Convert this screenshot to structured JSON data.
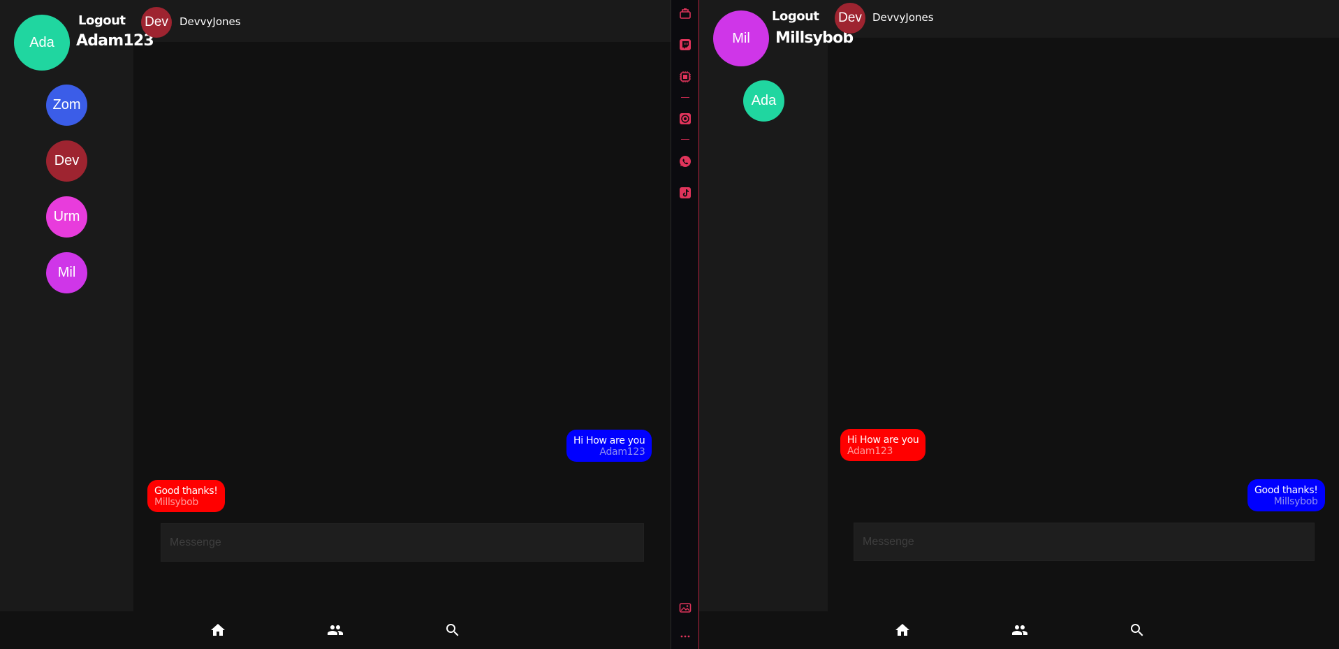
{
  "colors": {
    "background": "#111111",
    "panel": "#1a1a1a",
    "sent_bubble": "#0000ff",
    "received_bubble": "#ff0000",
    "accent_pink": "#e0345b"
  },
  "left": {
    "profile": {
      "initials": "Ada",
      "username": "Adam123",
      "color": "#20d6a0"
    },
    "logout_label": "Logout",
    "chat_header": {
      "initials": "Dev",
      "name": "DevvyJones",
      "color": "#9e2430"
    },
    "contacts": [
      {
        "initials": "Zom",
        "color": "#3b5de8"
      },
      {
        "initials": "Dev",
        "color": "#9e2430"
      },
      {
        "initials": "Urm",
        "color": "#e83cdc"
      },
      {
        "initials": "Mil",
        "color": "#cf36e8"
      }
    ],
    "messages": [
      {
        "text": "Hi How are you",
        "author": "Adam123",
        "side": "sent"
      },
      {
        "text": "Good thanks!",
        "author": "Millsybob",
        "side": "received"
      }
    ],
    "input_placeholder": "Messenge",
    "nav": [
      "home-icon",
      "people-icon",
      "search-icon"
    ]
  },
  "right": {
    "profile": {
      "initials": "Mil",
      "username": "Millsybob",
      "color": "#cf36e8"
    },
    "logout_label": "Logout",
    "chat_header": {
      "initials": "Dev",
      "name": "DevvyJones",
      "color": "#9e2430"
    },
    "contacts": [
      {
        "initials": "Ada",
        "color": "#20d6a0"
      }
    ],
    "messages": [
      {
        "text": "Hi How are you",
        "author": "Adam123",
        "side": "received"
      },
      {
        "text": "Good thanks!",
        "author": "Millsybob",
        "side": "sent"
      }
    ],
    "input_placeholder": "Messenge",
    "nav": [
      "home-icon",
      "people-icon",
      "search-icon"
    ]
  },
  "strip_icons": [
    "app-drawer-icon",
    "twitch-icon",
    "chip-icon",
    "target-icon",
    "whatsapp-icon",
    "tiktok-icon",
    "gallery-icon",
    "more-icon"
  ]
}
